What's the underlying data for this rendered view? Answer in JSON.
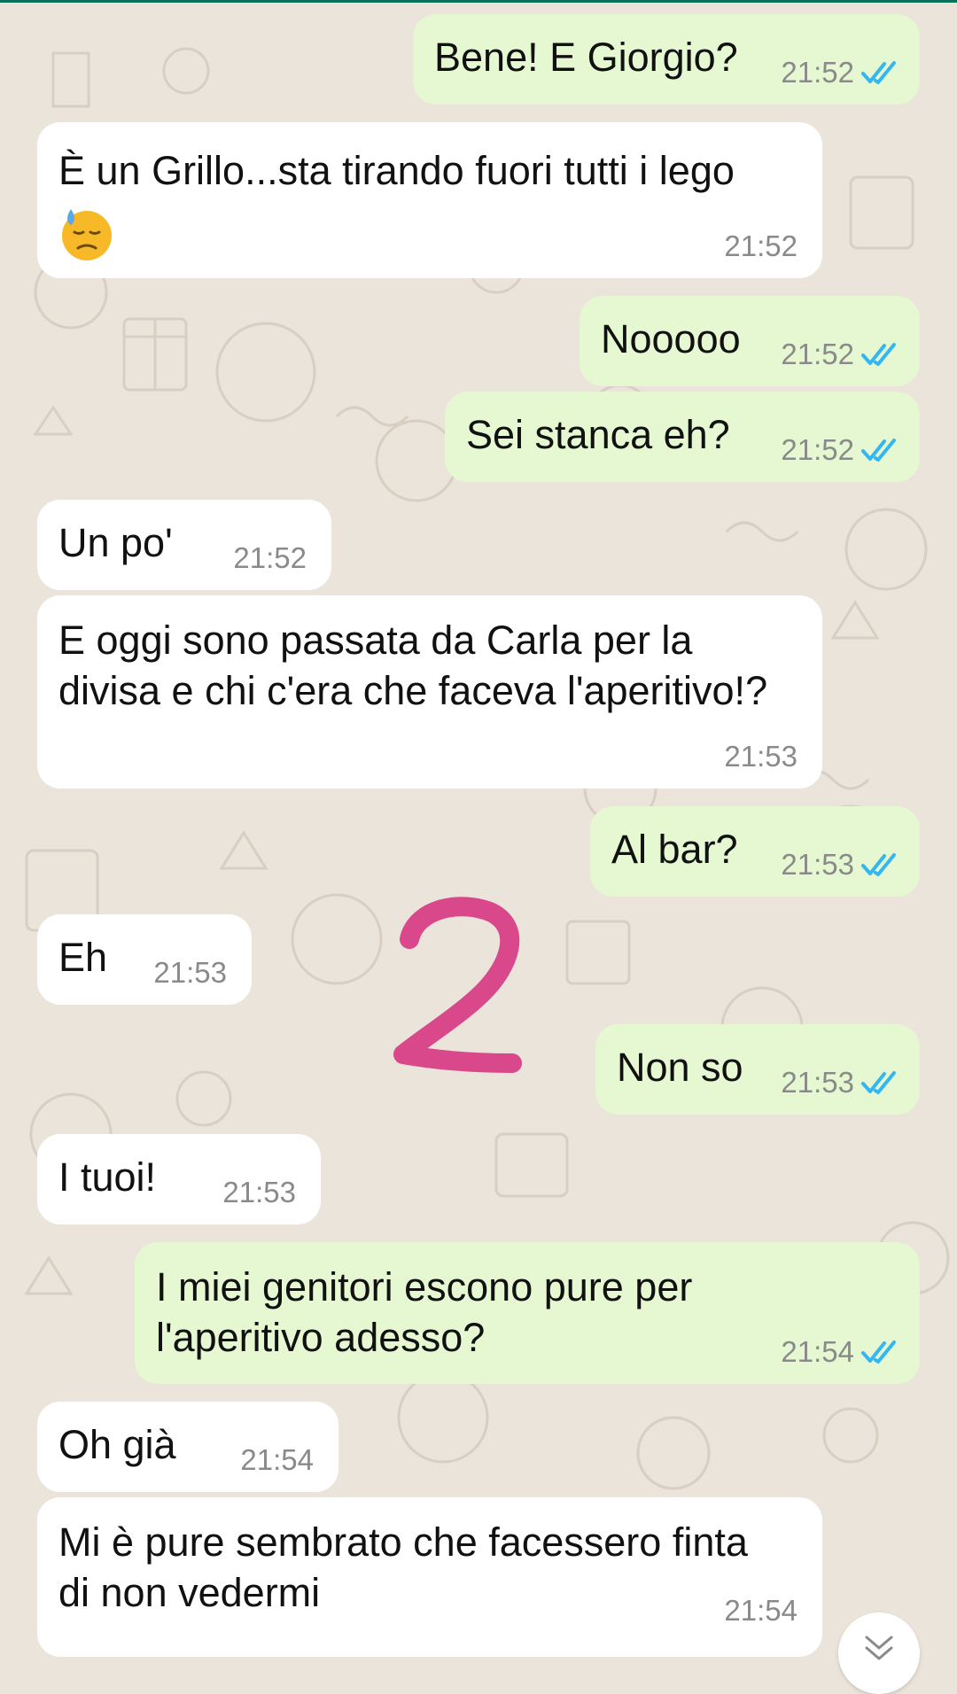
{
  "colors": {
    "background": "#ebe4da",
    "incoming_bubble": "#ffffff",
    "outgoing_bubble": "#e5f8d1",
    "read_ticks": "#34b7f1",
    "timestamp": "#8a8a8a",
    "annotation": "#d9488b"
  },
  "annotation": {
    "text": "2"
  },
  "messages": [
    {
      "direction": "out",
      "text": "Bene! E Giorgio?",
      "time": "21:52",
      "status_icon": "double-check-read-icon"
    },
    {
      "direction": "in",
      "text": "È un Grillo...sta tirando fuori tutti i lego",
      "emoji": "downcast-face-with-sweat-emoji",
      "time": "21:52"
    },
    {
      "direction": "out",
      "text": "Nooooo",
      "time": "21:52",
      "status_icon": "double-check-read-icon"
    },
    {
      "direction": "out",
      "text": "Sei stanca eh?",
      "time": "21:52",
      "status_icon": "double-check-read-icon"
    },
    {
      "direction": "in",
      "text": "Un po'",
      "time": "21:52"
    },
    {
      "direction": "in",
      "text": "E oggi sono passata da Carla per la\ndivisa e chi c'era che faceva l'aperitivo!?",
      "time": "21:53"
    },
    {
      "direction": "out",
      "text": "Al bar?",
      "time": "21:53",
      "status_icon": "double-check-read-icon"
    },
    {
      "direction": "in",
      "text": "Eh",
      "time": "21:53"
    },
    {
      "direction": "out",
      "text": "Non so",
      "time": "21:53",
      "status_icon": "double-check-read-icon"
    },
    {
      "direction": "in",
      "text": "I tuoi!",
      "time": "21:53"
    },
    {
      "direction": "out",
      "text": "I miei genitori escono pure per\nl'aperitivo adesso?",
      "time": "21:54",
      "status_icon": "double-check-read-icon"
    },
    {
      "direction": "in",
      "text": "Oh già",
      "time": "21:54"
    },
    {
      "direction": "in",
      "text": "Mi è pure sembrato che facessero finta\ndi non vedermi",
      "time": "21:54"
    }
  ],
  "scroll_button": {
    "icon": "double-chevron-down-icon"
  }
}
